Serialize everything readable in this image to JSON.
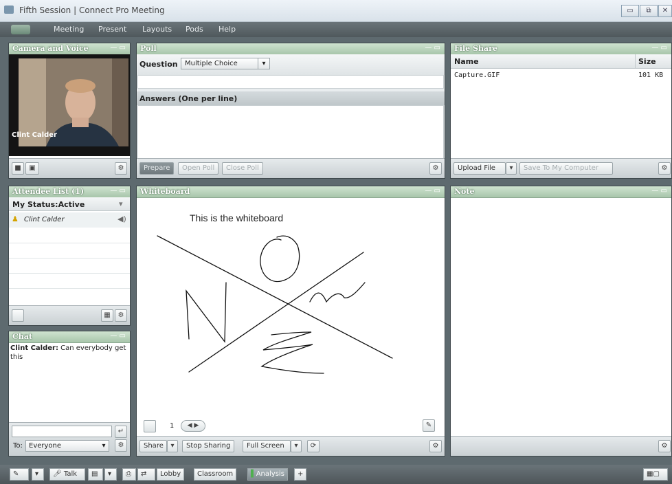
{
  "window": {
    "title": "Fifth Session | Connect Pro Meeting"
  },
  "menu": {
    "items": [
      "Meeting",
      "Present",
      "Layouts",
      "Pods",
      "Help"
    ]
  },
  "camera_pod": {
    "title": "Camera and Voice",
    "speaker": "Clint Calder"
  },
  "poll_pod": {
    "title": "Poll",
    "question_label": "Question",
    "type_value": "Multiple Choice",
    "answers_label": "Answers (One per line)",
    "buttons": {
      "prepare": "Prepare",
      "open": "Open Poll",
      "close": "Close Poll"
    }
  },
  "fileshare_pod": {
    "title": "File Share",
    "columns": {
      "name": "Name",
      "size": "Size"
    },
    "files": [
      {
        "name": "Capture.GIF",
        "size": "101 KB"
      }
    ],
    "upload_label": "Upload File",
    "save_label": "Save To My Computer"
  },
  "attendee_pod": {
    "title": "Attendee List (1)",
    "status_label": "My Status:Active",
    "attendees": [
      "Clint Calder"
    ]
  },
  "whiteboard_pod": {
    "title": "Whiteboard",
    "text": "This is the whiteboard",
    "page_number": "1",
    "share_label": "Share",
    "stop_label": "Stop Sharing",
    "fullscreen_label": "Full Screen"
  },
  "note_pod": {
    "title": "Note"
  },
  "chat_pod": {
    "title": "Chat",
    "message_sender": "Clint Calder:",
    "message_text": "Can everybody get this",
    "to_label": "To:",
    "recipient": "Everyone"
  },
  "taskbar": {
    "talk_label": "Talk",
    "layouts": [
      "Lobby",
      "Classroom",
      "Analysis"
    ],
    "add_label": "+"
  }
}
